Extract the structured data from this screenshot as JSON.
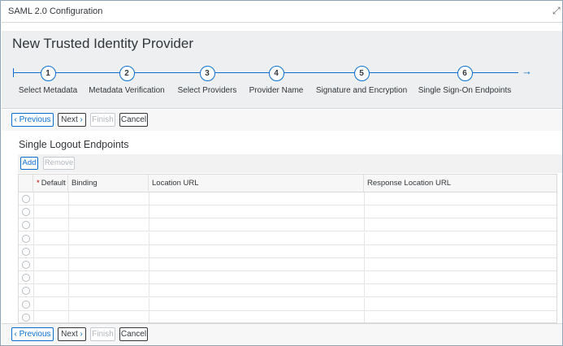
{
  "window": {
    "title": "SAML 2.0 Configuration",
    "expand_glyph": "⤢"
  },
  "page": {
    "heading": "New Trusted Identity Provider"
  },
  "wizard": {
    "arrow_glyph": "→",
    "steps": [
      {
        "number": "1",
        "label": "Select Metadata"
      },
      {
        "number": "2",
        "label": "Metadata Verification"
      },
      {
        "number": "3",
        "label": "Select Providers"
      },
      {
        "number": "4",
        "label": "Provider Name"
      },
      {
        "number": "5",
        "label": "Signature and Encryption"
      },
      {
        "number": "6",
        "label": "Single Sign-On Endpoints"
      }
    ]
  },
  "toolbar": {
    "previous_label": "Previous",
    "next_label": "Next",
    "finish_label": "Finish",
    "cancel_label": "Cancel",
    "chevron_left": "‹",
    "chevron_right": "›"
  },
  "section": {
    "title": "Single Logout Endpoints",
    "add_label": "Add",
    "remove_label": "Remove"
  },
  "table": {
    "required_marker": "*",
    "columns": [
      "Default",
      "Binding",
      "Location URL",
      "Response Location URL"
    ],
    "empty_row_count": 10
  },
  "colors": {
    "accent": "#0a6ed1",
    "header_bg": "#edeff0",
    "required": "#bb0000"
  }
}
